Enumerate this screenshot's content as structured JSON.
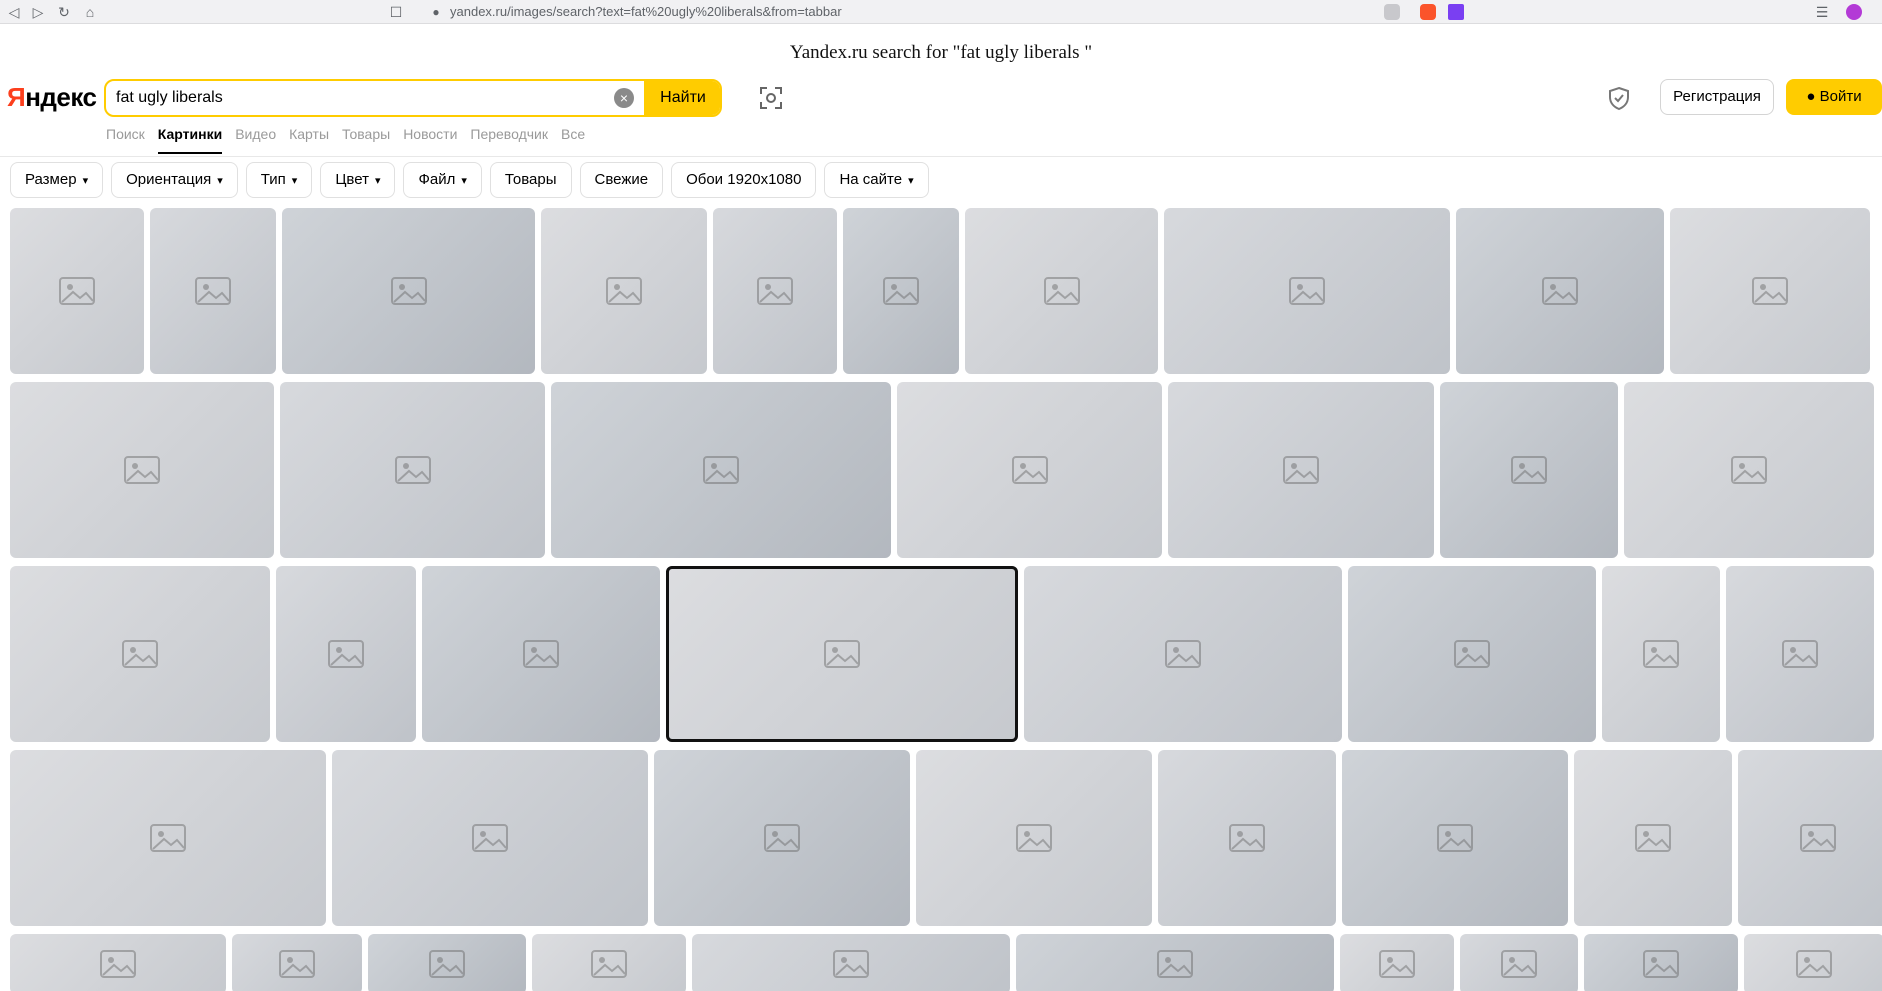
{
  "browser": {
    "url": "yandex.ru/images/search?text=fat%20ugly%20liberals&from=tabbar"
  },
  "page_caption": "Yandex.ru search for \"fat ugly  liberals \"",
  "header": {
    "logo_first": "Я",
    "logo_rest": "ндекс",
    "search_value": "fat ugly liberals",
    "search_button": "Найти",
    "register_button": "Регистрация",
    "login_button": "Войти"
  },
  "tabs": [
    "Поиск",
    "Картинки",
    "Видео",
    "Карты",
    "Товары",
    "Новости",
    "Переводчик",
    "Все"
  ],
  "active_tab": "Картинки",
  "filters": [
    {
      "label": "Размер",
      "dropdown": true
    },
    {
      "label": "Ориентация",
      "dropdown": true
    },
    {
      "label": "Тип",
      "dropdown": true
    },
    {
      "label": "Цвет",
      "dropdown": true
    },
    {
      "label": "Файл",
      "dropdown": true
    },
    {
      "label": "Товары",
      "dropdown": false
    },
    {
      "label": "Свежие",
      "dropdown": false
    },
    {
      "label": "Обои 1920x1080",
      "dropdown": false
    },
    {
      "label": "На сайте",
      "dropdown": true
    }
  ],
  "results": {
    "note_hidden": "",
    "row_thumb_counts": [
      10,
      7,
      8,
      8,
      10
    ]
  },
  "colors": {
    "accent": "#ffcc00",
    "logo_red": "#fc3f1d"
  }
}
